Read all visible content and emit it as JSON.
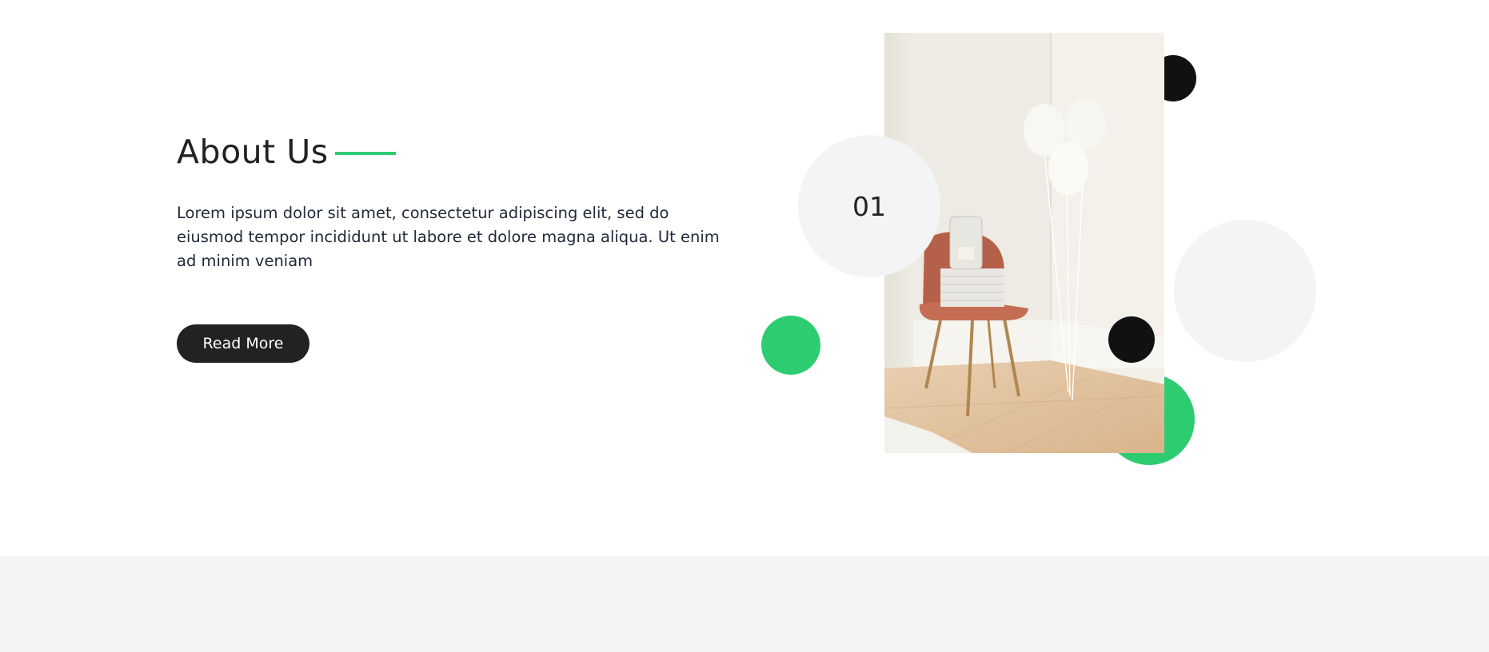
{
  "about": {
    "title": "About Us",
    "body": "Lorem ipsum dolor sit amet, consectetur adipiscing elit, sed do eiusmod tempor incididunt ut labore et dolore magna aliqua. Ut enim ad minim veniam",
    "button_label": "Read More",
    "badge_number": "01"
  },
  "colors": {
    "accent": "#2ecc71",
    "dark": "#222222",
    "light_grey": "#f3f4f6",
    "black": "#111111"
  },
  "image": {
    "subject": "room-interior-photo"
  }
}
